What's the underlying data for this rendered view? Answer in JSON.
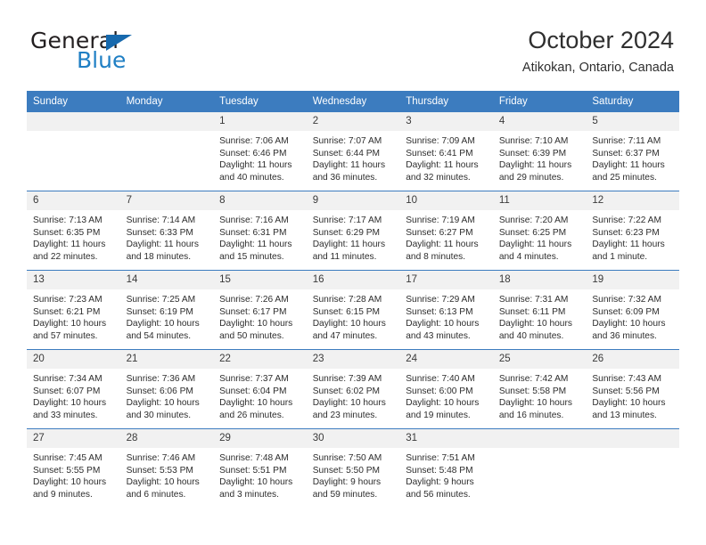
{
  "brand": {
    "word_one": "General",
    "word_two": "Blue",
    "triangle_icon": "triangle-icon",
    "accent_color": "#1f7fc4"
  },
  "header": {
    "title": "October 2024",
    "subtitle": "Atikokan, Ontario, Canada"
  },
  "theme": {
    "header_blue": "#3c7cbf",
    "daynum_band": "#f1f1f1",
    "text": "#2d2d2d"
  },
  "calendar": {
    "weekdays": [
      "Sunday",
      "Monday",
      "Tuesday",
      "Wednesday",
      "Thursday",
      "Friday",
      "Saturday"
    ],
    "weeks": [
      [
        {
          "day": "",
          "sunrise": "",
          "sunset": "",
          "daylight_line1": "",
          "daylight_line2": "",
          "empty": true
        },
        {
          "day": "",
          "sunrise": "",
          "sunset": "",
          "daylight_line1": "",
          "daylight_line2": "",
          "empty": true
        },
        {
          "day": "1",
          "sunrise": "Sunrise: 7:06 AM",
          "sunset": "Sunset: 6:46 PM",
          "daylight_line1": "Daylight: 11 hours",
          "daylight_line2": "and 40 minutes."
        },
        {
          "day": "2",
          "sunrise": "Sunrise: 7:07 AM",
          "sunset": "Sunset: 6:44 PM",
          "daylight_line1": "Daylight: 11 hours",
          "daylight_line2": "and 36 minutes."
        },
        {
          "day": "3",
          "sunrise": "Sunrise: 7:09 AM",
          "sunset": "Sunset: 6:41 PM",
          "daylight_line1": "Daylight: 11 hours",
          "daylight_line2": "and 32 minutes."
        },
        {
          "day": "4",
          "sunrise": "Sunrise: 7:10 AM",
          "sunset": "Sunset: 6:39 PM",
          "daylight_line1": "Daylight: 11 hours",
          "daylight_line2": "and 29 minutes."
        },
        {
          "day": "5",
          "sunrise": "Sunrise: 7:11 AM",
          "sunset": "Sunset: 6:37 PM",
          "daylight_line1": "Daylight: 11 hours",
          "daylight_line2": "and 25 minutes."
        }
      ],
      [
        {
          "day": "6",
          "sunrise": "Sunrise: 7:13 AM",
          "sunset": "Sunset: 6:35 PM",
          "daylight_line1": "Daylight: 11 hours",
          "daylight_line2": "and 22 minutes."
        },
        {
          "day": "7",
          "sunrise": "Sunrise: 7:14 AM",
          "sunset": "Sunset: 6:33 PM",
          "daylight_line1": "Daylight: 11 hours",
          "daylight_line2": "and 18 minutes."
        },
        {
          "day": "8",
          "sunrise": "Sunrise: 7:16 AM",
          "sunset": "Sunset: 6:31 PM",
          "daylight_line1": "Daylight: 11 hours",
          "daylight_line2": "and 15 minutes."
        },
        {
          "day": "9",
          "sunrise": "Sunrise: 7:17 AM",
          "sunset": "Sunset: 6:29 PM",
          "daylight_line1": "Daylight: 11 hours",
          "daylight_line2": "and 11 minutes."
        },
        {
          "day": "10",
          "sunrise": "Sunrise: 7:19 AM",
          "sunset": "Sunset: 6:27 PM",
          "daylight_line1": "Daylight: 11 hours",
          "daylight_line2": "and 8 minutes."
        },
        {
          "day": "11",
          "sunrise": "Sunrise: 7:20 AM",
          "sunset": "Sunset: 6:25 PM",
          "daylight_line1": "Daylight: 11 hours",
          "daylight_line2": "and 4 minutes."
        },
        {
          "day": "12",
          "sunrise": "Sunrise: 7:22 AM",
          "sunset": "Sunset: 6:23 PM",
          "daylight_line1": "Daylight: 11 hours",
          "daylight_line2": "and 1 minute."
        }
      ],
      [
        {
          "day": "13",
          "sunrise": "Sunrise: 7:23 AM",
          "sunset": "Sunset: 6:21 PM",
          "daylight_line1": "Daylight: 10 hours",
          "daylight_line2": "and 57 minutes."
        },
        {
          "day": "14",
          "sunrise": "Sunrise: 7:25 AM",
          "sunset": "Sunset: 6:19 PM",
          "daylight_line1": "Daylight: 10 hours",
          "daylight_line2": "and 54 minutes."
        },
        {
          "day": "15",
          "sunrise": "Sunrise: 7:26 AM",
          "sunset": "Sunset: 6:17 PM",
          "daylight_line1": "Daylight: 10 hours",
          "daylight_line2": "and 50 minutes."
        },
        {
          "day": "16",
          "sunrise": "Sunrise: 7:28 AM",
          "sunset": "Sunset: 6:15 PM",
          "daylight_line1": "Daylight: 10 hours",
          "daylight_line2": "and 47 minutes."
        },
        {
          "day": "17",
          "sunrise": "Sunrise: 7:29 AM",
          "sunset": "Sunset: 6:13 PM",
          "daylight_line1": "Daylight: 10 hours",
          "daylight_line2": "and 43 minutes."
        },
        {
          "day": "18",
          "sunrise": "Sunrise: 7:31 AM",
          "sunset": "Sunset: 6:11 PM",
          "daylight_line1": "Daylight: 10 hours",
          "daylight_line2": "and 40 minutes."
        },
        {
          "day": "19",
          "sunrise": "Sunrise: 7:32 AM",
          "sunset": "Sunset: 6:09 PM",
          "daylight_line1": "Daylight: 10 hours",
          "daylight_line2": "and 36 minutes."
        }
      ],
      [
        {
          "day": "20",
          "sunrise": "Sunrise: 7:34 AM",
          "sunset": "Sunset: 6:07 PM",
          "daylight_line1": "Daylight: 10 hours",
          "daylight_line2": "and 33 minutes."
        },
        {
          "day": "21",
          "sunrise": "Sunrise: 7:36 AM",
          "sunset": "Sunset: 6:06 PM",
          "daylight_line1": "Daylight: 10 hours",
          "daylight_line2": "and 30 minutes."
        },
        {
          "day": "22",
          "sunrise": "Sunrise: 7:37 AM",
          "sunset": "Sunset: 6:04 PM",
          "daylight_line1": "Daylight: 10 hours",
          "daylight_line2": "and 26 minutes."
        },
        {
          "day": "23",
          "sunrise": "Sunrise: 7:39 AM",
          "sunset": "Sunset: 6:02 PM",
          "daylight_line1": "Daylight: 10 hours",
          "daylight_line2": "and 23 minutes."
        },
        {
          "day": "24",
          "sunrise": "Sunrise: 7:40 AM",
          "sunset": "Sunset: 6:00 PM",
          "daylight_line1": "Daylight: 10 hours",
          "daylight_line2": "and 19 minutes."
        },
        {
          "day": "25",
          "sunrise": "Sunrise: 7:42 AM",
          "sunset": "Sunset: 5:58 PM",
          "daylight_line1": "Daylight: 10 hours",
          "daylight_line2": "and 16 minutes."
        },
        {
          "day": "26",
          "sunrise": "Sunrise: 7:43 AM",
          "sunset": "Sunset: 5:56 PM",
          "daylight_line1": "Daylight: 10 hours",
          "daylight_line2": "and 13 minutes."
        }
      ],
      [
        {
          "day": "27",
          "sunrise": "Sunrise: 7:45 AM",
          "sunset": "Sunset: 5:55 PM",
          "daylight_line1": "Daylight: 10 hours",
          "daylight_line2": "and 9 minutes."
        },
        {
          "day": "28",
          "sunrise": "Sunrise: 7:46 AM",
          "sunset": "Sunset: 5:53 PM",
          "daylight_line1": "Daylight: 10 hours",
          "daylight_line2": "and 6 minutes."
        },
        {
          "day": "29",
          "sunrise": "Sunrise: 7:48 AM",
          "sunset": "Sunset: 5:51 PM",
          "daylight_line1": "Daylight: 10 hours",
          "daylight_line2": "and 3 minutes."
        },
        {
          "day": "30",
          "sunrise": "Sunrise: 7:50 AM",
          "sunset": "Sunset: 5:50 PM",
          "daylight_line1": "Daylight: 9 hours",
          "daylight_line2": "and 59 minutes."
        },
        {
          "day": "31",
          "sunrise": "Sunrise: 7:51 AM",
          "sunset": "Sunset: 5:48 PM",
          "daylight_line1": "Daylight: 9 hours",
          "daylight_line2": "and 56 minutes."
        },
        {
          "day": "",
          "sunrise": "",
          "sunset": "",
          "daylight_line1": "",
          "daylight_line2": "",
          "empty": true
        },
        {
          "day": "",
          "sunrise": "",
          "sunset": "",
          "daylight_line1": "",
          "daylight_line2": "",
          "empty": true
        }
      ]
    ]
  }
}
